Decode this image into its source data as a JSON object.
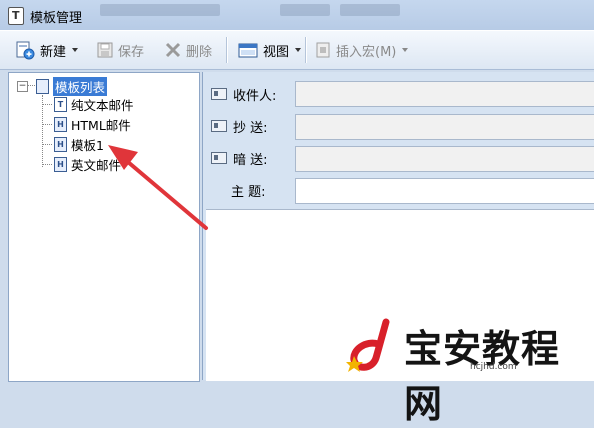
{
  "window": {
    "title": "模板管理"
  },
  "toolbar": {
    "new_label": "新建",
    "save_label": "保存",
    "delete_label": "删除",
    "view_label": "视图",
    "insert_macro_label": "插入宏(M)"
  },
  "tree": {
    "root_label": "模板列表",
    "items": [
      {
        "label": "纯文本邮件",
        "icon": "text-doc-icon"
      },
      {
        "label": "HTML邮件",
        "icon": "html-doc-icon"
      },
      {
        "label": "模板1",
        "icon": "html-doc-icon"
      },
      {
        "label": "英文邮件",
        "icon": "html-doc-icon"
      }
    ]
  },
  "form": {
    "recipient_label": "收件人:",
    "cc_label": "抄 送:",
    "bcc_label": "暗 送:",
    "subject_label": "主 题:",
    "recipient_value": "",
    "cc_value": "",
    "bcc_value": "",
    "subject_value": ""
  },
  "watermark": {
    "text": "宝安教程网",
    "sub": "hcjhd.com"
  },
  "colors": {
    "selection": "#3a7bd5",
    "arrow": "#e0353a",
    "panel_bg": "#d6e3f2"
  }
}
